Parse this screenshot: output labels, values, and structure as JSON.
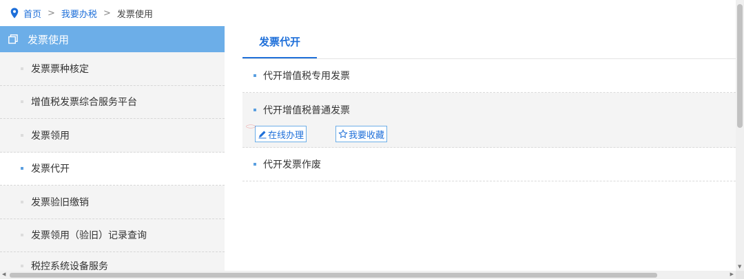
{
  "breadcrumb": {
    "home": "首页",
    "sep1": ">",
    "level2": "我要办税",
    "sep2": ">",
    "current": "发票使用"
  },
  "sidebar": {
    "header": "发票使用",
    "items": [
      {
        "label": "发票票种核定",
        "active": false
      },
      {
        "label": "增值税发票综合服务平台",
        "active": false
      },
      {
        "label": "发票领用",
        "active": false
      },
      {
        "label": "发票代开",
        "active": true
      },
      {
        "label": "发票验旧缴销",
        "active": false
      },
      {
        "label": "发票领用（验旧）记录查询",
        "active": false
      },
      {
        "label": "税控系统设备服务",
        "active": false
      }
    ]
  },
  "main": {
    "tab": "发票代开",
    "rows": [
      {
        "label": "代开增值税专用发票"
      },
      {
        "label": "代开增值税普通发票"
      },
      {
        "label": "代开发票作废"
      }
    ],
    "actions": {
      "online": "在线办理",
      "favorite": "我要收藏"
    }
  },
  "colors": {
    "accent": "#1e6fd9",
    "sidebar_header": "#6caee8",
    "highlight_ellipse": "#e02020"
  },
  "icons": [
    "location-pin-icon",
    "copy-icon",
    "pencil-icon",
    "star-icon"
  ]
}
